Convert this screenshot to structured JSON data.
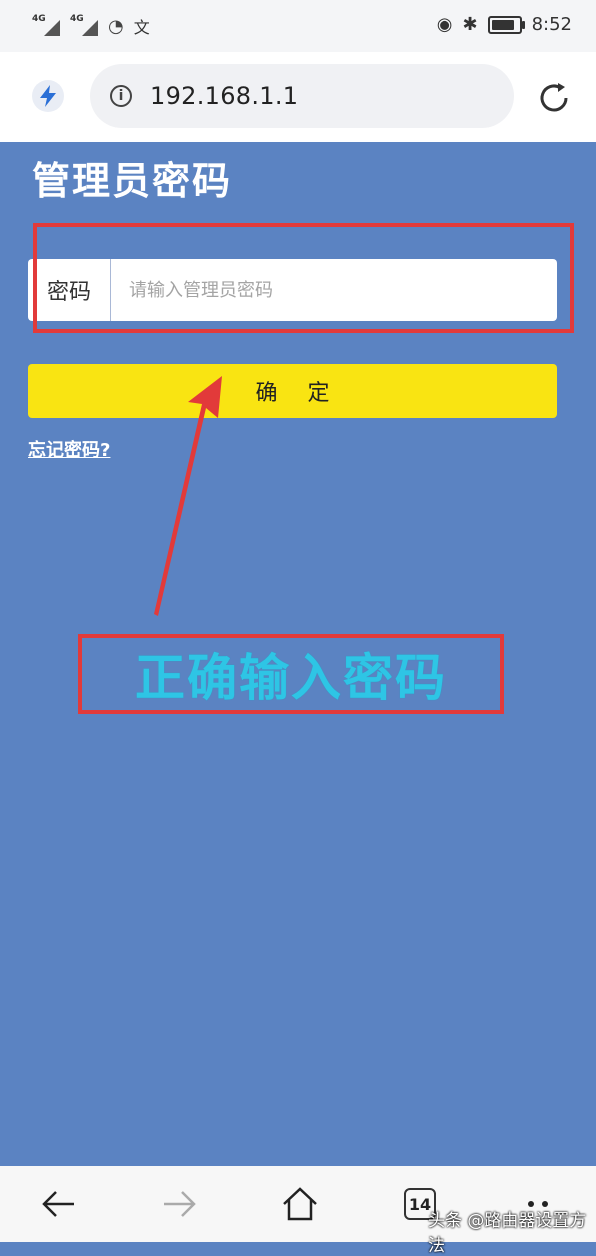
{
  "status_bar": {
    "sim1_label": "4G",
    "sim2_label": "4G",
    "lang_icon": "文",
    "time": "8:52"
  },
  "browser": {
    "url": "192.168.1.1"
  },
  "page": {
    "title": "管理员密码",
    "password_label": "密码",
    "password_value": "",
    "password_placeholder": "请输入管理员密码",
    "confirm_label": "确定",
    "forgot_link": "忘记密码?"
  },
  "annotation": {
    "note": "正确输入密码"
  },
  "bottom_nav": {
    "tab_count": "14"
  },
  "watermark": "头条 @路由器设置方法",
  "colors": {
    "page_background": "#5b83c2",
    "confirm_button": "#f9e412",
    "annotation_box": "#e23a3a",
    "annotation_text": "#2ec5e5"
  }
}
